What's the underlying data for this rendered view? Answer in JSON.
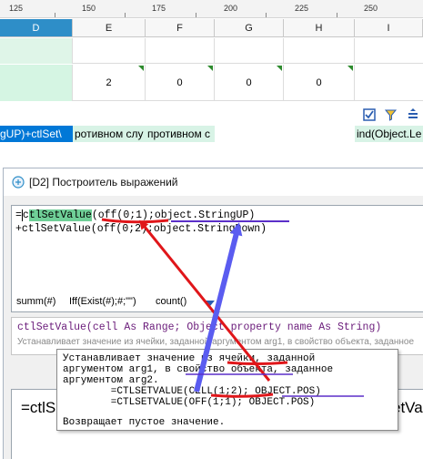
{
  "ruler": {
    "ticks": [
      "125",
      "150",
      "175",
      "200",
      "225",
      "250"
    ]
  },
  "columns": [
    "D",
    "E",
    "F",
    "G",
    "H",
    "I"
  ],
  "grid_values": [
    "2",
    "0",
    "0",
    "0"
  ],
  "strip_texts": [
    "gUP)+ctlSet\\",
    "ротивном слу",
    "противном с",
    "ind(Object.Le"
  ],
  "dialog": {
    "title": "[D2] Построитель выражений",
    "code_line1_pre": "=",
    "code_line1_cursor": "c",
    "code_line1_hl": "tlSetValue",
    "code_line1_rest": "(off(0;1);object.StringUP)",
    "code_line2": "+ctlSetValue(off(0;2);object.StringDown)",
    "func_bar": [
      "summ(#)",
      "Iff(Exist(#);#;\"\")",
      "count()"
    ],
    "signature": "ctlSetValue(cell As Range; Object property name As String)",
    "signature_desc": "Устанавливает значение из ячейки, заданной аргументом arg1, в свойство объекта, заданное",
    "big_text_left": "=ctlS",
    "big_text_right": "etVa"
  },
  "tooltip": {
    "lines": [
      "Устанавливает значение из ячейки, заданной",
      "аргументом arg1, в свойство объекта, заданное",
      "аргументом arg2.",
      "        =CTLSETVALUE(CELL(1;2); OBJECT.POS)",
      "        =CTLSETVALUE(OFF(1;1); OBJECT.POS)",
      "",
      "Возвращает пустое значение."
    ]
  },
  "colors": {
    "accent": "#2e8ec8",
    "highlight": "#6fcf97",
    "arrow_red": "#e0161a",
    "arrow_blue": "#5a5cf0",
    "underline_purple": "#5b2fc9"
  }
}
